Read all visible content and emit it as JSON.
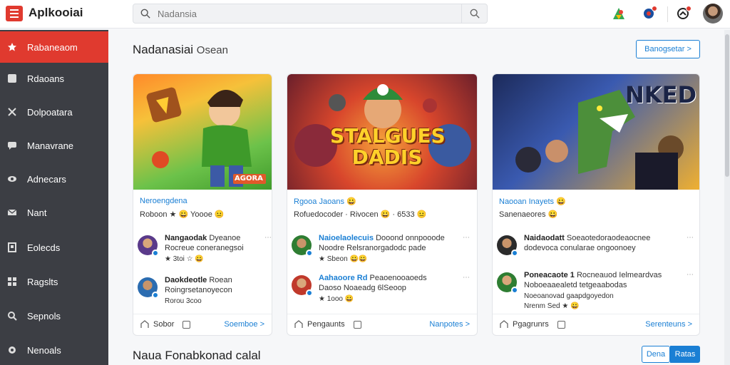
{
  "app": {
    "title": "Aplkooiai"
  },
  "search": {
    "placeholder": "Nadansia"
  },
  "sidebar": {
    "items": [
      {
        "label": "Rabaneaom",
        "icon": "star-icon",
        "active": true
      },
      {
        "label": "Rdaoans",
        "icon": "square-icon"
      },
      {
        "label": "Dolpoatara",
        "icon": "tools-icon"
      },
      {
        "label": "Manavrane",
        "icon": "chat-icon"
      },
      {
        "label": "Adnecars",
        "icon": "eye-icon"
      },
      {
        "label": "Nant",
        "icon": "envelope-icon"
      },
      {
        "label": "Eolecds",
        "icon": "book-icon"
      },
      {
        "label": "Ragslts",
        "icon": "grid-icon"
      },
      {
        "label": "Sepnols",
        "icon": "search-icon"
      },
      {
        "label": "Nenoals",
        "icon": "settings-icon"
      }
    ]
  },
  "main": {
    "section_title": "Nadanasiai",
    "section_subtitle": "Osean",
    "manage_button": "Banogsetar >",
    "bottom_title": "Naua Fonabkonad calal",
    "bottom_buttons": [
      "Dena",
      "Ratas"
    ]
  },
  "cards": [
    {
      "game_title": "AGORA",
      "head": "Neroengdena",
      "sub": "Roboon ★ 😀 Yoooe 😐",
      "reviews": [
        {
          "name": "Nangaodak",
          "text": "Dyeanoe",
          "line2": "Rocreue coneranegsoi",
          "line3": "★ 3toi ☆ 😀"
        },
        {
          "name": "Daokdeotle",
          "text": "Roean",
          "line2": "Roingrsetanoyecon",
          "line3": "Rorou 3coo"
        }
      ],
      "footer_share": "Sobor",
      "footer_see": "Soemboe >"
    },
    {
      "game_title": "STALGUES DADIS",
      "head": "Rgooa Jaoans 😀",
      "sub": "Rofuedocoder · Rivocen 😀 · 6533 😐",
      "reviews": [
        {
          "name": "Naioelaolecuis",
          "text": "Dooond onnpooode",
          "line2": "Noodre Relsranorgadodc pade",
          "line3": "★ Sbeon 😀😀"
        },
        {
          "name": "Aahaoore Rd",
          "text": "Peaoenooaoeds",
          "line2": "Daoso Noaeadg 6lSeoop",
          "line3": "★ 1ooo 😀"
        }
      ],
      "footer_share": "Pengaunts",
      "footer_see": "Nanpotes >"
    },
    {
      "game_title": "NKED",
      "head": "Naooan Inayets 😀",
      "sub": "Sanenaeores 😀",
      "reviews": [
        {
          "name": "Naidaodatt",
          "text": "Soeaotedoraodeaocnee",
          "line2": "dodevoca conularae ongoonoey",
          "line3": ""
        },
        {
          "name": "Poneacaote 1",
          "text": "Rocneauod Ielmeardvas",
          "line2": "Noboeaaealetd tetgeaabodas",
          "line3": "Noeoanovad gaapdgoyedon"
        }
      ],
      "review_extra": "Nrenm Sed ★ 😀",
      "footer_share": "Pgagrunrs",
      "footer_see": "Serenteuns >"
    }
  ]
}
